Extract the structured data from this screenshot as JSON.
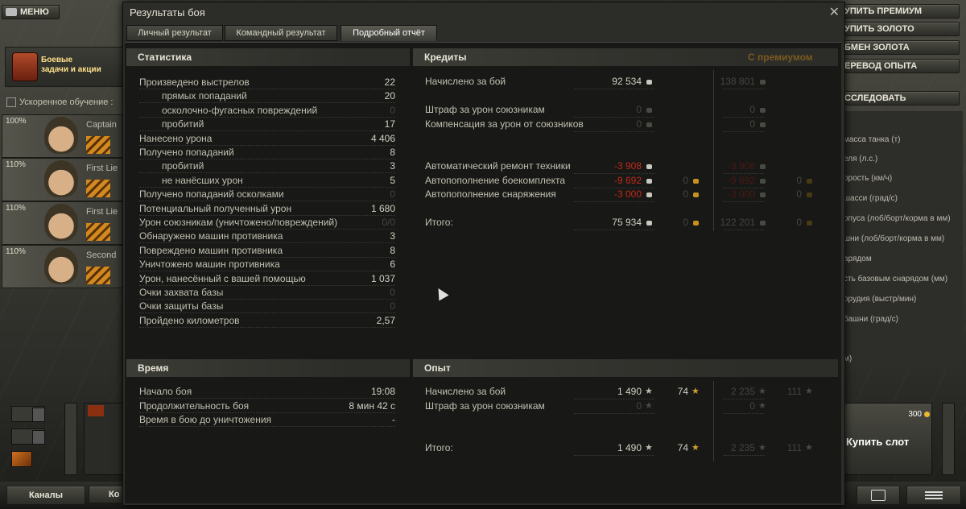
{
  "garage": {
    "menu_label": "МЕНЮ",
    "missions_line1": "Боевые",
    "missions_line2": "задачи и акции",
    "accel_training": "Ускоренное обучение :",
    "crew": [
      {
        "pct": "100%",
        "rank": "Captain"
      },
      {
        "pct": "110%",
        "rank": "First Lie"
      },
      {
        "pct": "110%",
        "rank": "First Lie"
      },
      {
        "pct": "110%",
        "rank": "Second"
      }
    ],
    "right_buttons": [
      "УПИТЬ ПРЕМИУМ",
      "УПИТЬ ЗОЛОТО",
      "БМЕН ЗОЛОТА",
      "ЕРЕВОД ОПЫТА",
      "ССЛЕДОВАТЬ"
    ],
    "right_list": [
      "масса танка (т)",
      "еля (л.с.)",
      "орость (км/ч)",
      "шасси (град/с)",
      "опуса (лоб/борт/корма в мм)",
      "шни (лоб/борт/корма в мм)",
      "арядом",
      "сть базовым снарядом (мм)",
      "орудия (выстр/мин)",
      "башни (град/с)",
      "м)"
    ],
    "slot_price": "300",
    "buy_slot": "Купить слот",
    "channels": "Каналы",
    "channels2": "Ко"
  },
  "dialog": {
    "title": "Результаты боя",
    "tabs": [
      "Личный результат",
      "Командный результат",
      "Подробный отчёт"
    ],
    "active_tab": 2
  },
  "stats": {
    "header": "Статистика",
    "rows": [
      {
        "label": "Произведено выстрелов",
        "value": "22",
        "indent": false,
        "dim": false
      },
      {
        "label": "прямых попаданий",
        "value": "20",
        "indent": true,
        "dim": false
      },
      {
        "label": "осколочно-фугасных повреждений",
        "value": "0",
        "indent": true,
        "dim": true
      },
      {
        "label": "пробитий",
        "value": "17",
        "indent": true,
        "dim": false
      },
      {
        "label": "Нанесено урона",
        "value": "4 406",
        "indent": false,
        "dim": false
      },
      {
        "label": "Получено попаданий",
        "value": "8",
        "indent": false,
        "dim": false
      },
      {
        "label": "пробитий",
        "value": "3",
        "indent": true,
        "dim": false
      },
      {
        "label": "не нанёсших урон",
        "value": "5",
        "indent": true,
        "dim": false
      },
      {
        "label": "Получено попаданий осколками",
        "value": "0",
        "indent": false,
        "dim": true
      },
      {
        "label": "Потенциальный полученный урон",
        "value": "1 680",
        "indent": false,
        "dim": false
      },
      {
        "label": "Урон союзникам (уничтожено/повреждений)",
        "value": "0/0",
        "indent": false,
        "dim": true
      },
      {
        "label": "Обнаружено машин противника",
        "value": "3",
        "indent": false,
        "dim": false
      },
      {
        "label": "Повреждено машин противника",
        "value": "8",
        "indent": false,
        "dim": false
      },
      {
        "label": "Уничтожено машин противника",
        "value": "6",
        "indent": false,
        "dim": false
      },
      {
        "label": "Урон, нанесённый с вашей помощью",
        "value": "1 037",
        "indent": false,
        "dim": false
      },
      {
        "label": "Очки захвата базы",
        "value": "0",
        "indent": false,
        "dim": true
      },
      {
        "label": "Очки защиты базы",
        "value": "0",
        "indent": false,
        "dim": true
      },
      {
        "label": "Пройдено километров",
        "value": "2,57",
        "indent": false,
        "dim": false
      }
    ]
  },
  "credits": {
    "header": "Кредиты",
    "premium_header": "С премиумом",
    "rows": [
      {
        "label": "Начислено за бой",
        "value": "92 534",
        "value_dim": false,
        "value_red": false,
        "gold": "",
        "prem_value": "138 801",
        "prem_dim": true,
        "prem_gold": ""
      },
      {
        "label": "",
        "value": "",
        "value_dim": false,
        "value_red": false,
        "gold": "",
        "prem_value": "",
        "prem_dim": true,
        "prem_gold": ""
      },
      {
        "label": "Штраф за урон союзникам",
        "value": "0",
        "value_dim": true,
        "value_red": false,
        "gold": "",
        "prem_value": "0",
        "prem_dim": true,
        "prem_gold": ""
      },
      {
        "label": "Компенсация за урон от союзников",
        "value": "0",
        "value_dim": true,
        "value_red": false,
        "gold": "",
        "prem_value": "0",
        "prem_dim": true,
        "prem_gold": ""
      },
      {
        "label": "",
        "value": "",
        "value_dim": false,
        "value_red": false,
        "gold": "",
        "prem_value": "",
        "prem_dim": true,
        "prem_gold": ""
      },
      {
        "label": "",
        "value": "",
        "value_dim": false,
        "value_red": false,
        "gold": "",
        "prem_value": "",
        "prem_dim": true,
        "prem_gold": ""
      },
      {
        "label": "Автоматический ремонт техники",
        "value": "-3 908",
        "value_dim": false,
        "value_red": true,
        "gold": "",
        "prem_value": "-3 908",
        "prem_dim": true,
        "prem_gold": ""
      },
      {
        "label": "Автопополнение боекомплекта",
        "value": "-9 692",
        "value_dim": false,
        "value_red": true,
        "gold": "0",
        "prem_value": "-9 692",
        "prem_dim": true,
        "prem_gold": "0"
      },
      {
        "label": "Автопополнение снаряжения",
        "value": "-3 000",
        "value_dim": false,
        "value_red": true,
        "gold": "0",
        "prem_value": "-3 000",
        "prem_dim": true,
        "prem_gold": "0"
      },
      {
        "label": "",
        "value": "",
        "value_dim": false,
        "value_red": false,
        "gold": "",
        "prem_value": "",
        "prem_dim": true,
        "prem_gold": ""
      },
      {
        "label": "Итого:",
        "value": "75 934",
        "value_dim": false,
        "value_red": false,
        "gold": "0",
        "prem_value": "122 201",
        "prem_dim": true,
        "prem_gold": "0"
      }
    ]
  },
  "time": {
    "header": "Время",
    "rows": [
      {
        "label": "Начало боя",
        "value": "19:08"
      },
      {
        "label": "Продолжительность боя",
        "value": "8 мин 42 с"
      },
      {
        "label": "Время в бою до уничтожения",
        "value": "-"
      }
    ]
  },
  "xp": {
    "header": "Опыт",
    "rows": [
      {
        "label": "Начислено за бой",
        "xp": "1 490",
        "free": "74",
        "prem_xp": "2 235",
        "prem_free": "111"
      },
      {
        "label": "Штраф за урон союзникам",
        "xp": "0",
        "free": "",
        "prem_xp": "0",
        "prem_free": ""
      },
      {
        "label": "",
        "xp": "",
        "free": "",
        "prem_xp": "",
        "prem_free": ""
      },
      {
        "label": "Итого:",
        "xp": "1 490",
        "free": "74",
        "prem_xp": "2 235",
        "prem_free": "111"
      }
    ]
  }
}
